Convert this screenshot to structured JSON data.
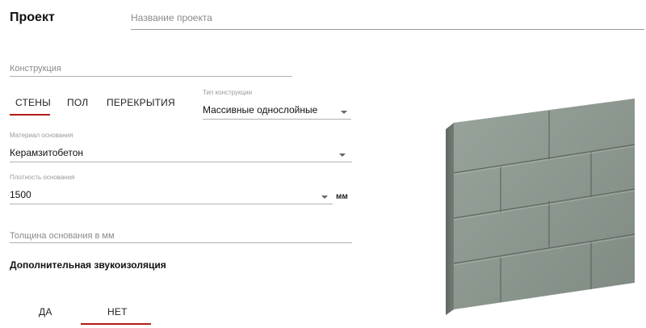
{
  "header": {
    "title": "Проект",
    "project_name_placeholder": "Название проекта"
  },
  "construction": {
    "placeholder": "Конструкция"
  },
  "tabs": [
    {
      "label": "СТЕНЫ",
      "active": true
    },
    {
      "label": "ПОЛ",
      "active": false
    },
    {
      "label": "ПЕРЕКРЫТИЯ",
      "active": false
    }
  ],
  "construction_type": {
    "label": "Тип конструкции",
    "value": "Массивные однослойные"
  },
  "base_material": {
    "label": "Материал основания",
    "value": "Керамзитобетон"
  },
  "base_density": {
    "label": "Плотность основания",
    "value": "1500",
    "unit": "мм"
  },
  "base_thickness": {
    "placeholder": "Толщина основания в мм"
  },
  "insulation": {
    "heading": "Дополнительная звукоизоляция",
    "options": [
      {
        "label": "ДА",
        "active": false
      },
      {
        "label": "НЕТ",
        "active": true
      }
    ]
  },
  "colors": {
    "accent": "#b31b1b",
    "block_face": "#8e9a92",
    "block_edge": "#6c756f"
  },
  "image": {
    "name": "masonry-wall-image"
  }
}
